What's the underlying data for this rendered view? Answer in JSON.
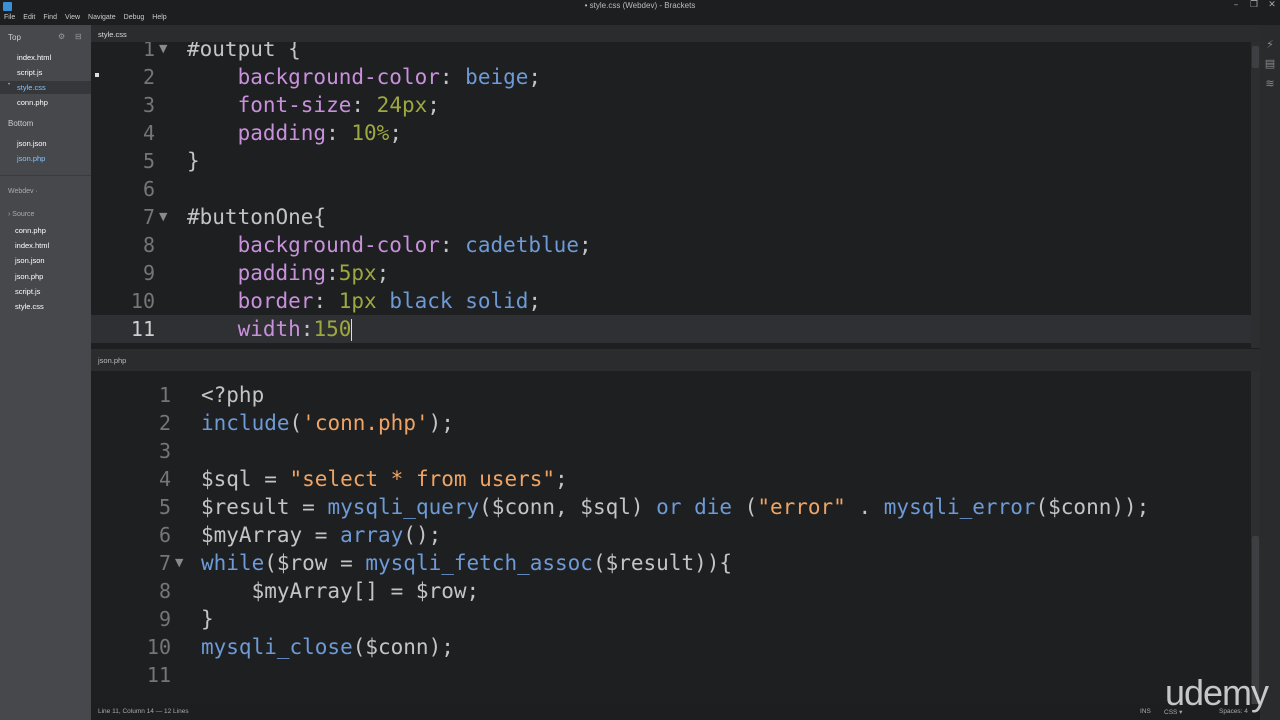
{
  "window": {
    "title": "• style.css (Webdev) - Brackets",
    "controls": [
      "–",
      "❐",
      "✕"
    ]
  },
  "menu": [
    "File",
    "Edit",
    "Find",
    "View",
    "Navigate",
    "Debug",
    "Help"
  ],
  "sidebar": {
    "top_label": "Top",
    "top_files": [
      "index.html",
      "script.js",
      "style.css",
      "conn.php"
    ],
    "bottom_label": "Bottom",
    "bottom_files": [
      "json.json",
      "json.php"
    ],
    "project_label": "Webdev ·",
    "source_label": "› Source",
    "source_files": [
      "conn.php",
      "index.html",
      "json.json",
      "json.php",
      "script.js",
      "style.css"
    ]
  },
  "top_pane": {
    "tab": "style.css",
    "lines": [
      "1",
      "2",
      "3",
      "4",
      "5",
      "6",
      "7",
      "8",
      "9",
      "10",
      "11"
    ],
    "code": [
      [
        {
          "t": "#output {",
          "c": "c-sel"
        }
      ],
      [
        {
          "t": "    background-color",
          "c": "c-prop"
        },
        {
          "t": ": ",
          "c": "c-plain"
        },
        {
          "t": "beige",
          "c": "c-val"
        },
        {
          "t": ";",
          "c": "c-plain"
        }
      ],
      [
        {
          "t": "    font-size",
          "c": "c-prop"
        },
        {
          "t": ": ",
          "c": "c-plain"
        },
        {
          "t": "24px",
          "c": "c-num"
        },
        {
          "t": ";",
          "c": "c-plain"
        }
      ],
      [
        {
          "t": "    padding",
          "c": "c-prop"
        },
        {
          "t": ": ",
          "c": "c-plain"
        },
        {
          "t": "10%",
          "c": "c-num"
        },
        {
          "t": ";",
          "c": "c-plain"
        }
      ],
      [
        {
          "t": "}",
          "c": "c-plain"
        }
      ],
      [],
      [
        {
          "t": "#buttonOne{",
          "c": "c-sel"
        }
      ],
      [
        {
          "t": "    background-color",
          "c": "c-prop"
        },
        {
          "t": ": ",
          "c": "c-plain"
        },
        {
          "t": "cadetblue",
          "c": "c-val"
        },
        {
          "t": ";",
          "c": "c-plain"
        }
      ],
      [
        {
          "t": "    padding",
          "c": "c-prop"
        },
        {
          "t": ":",
          "c": "c-plain"
        },
        {
          "t": "5px",
          "c": "c-num"
        },
        {
          "t": ";",
          "c": "c-plain"
        }
      ],
      [
        {
          "t": "    border",
          "c": "c-prop"
        },
        {
          "t": ": ",
          "c": "c-plain"
        },
        {
          "t": "1px",
          "c": "c-num"
        },
        {
          "t": " ",
          "c": "c-plain"
        },
        {
          "t": "black",
          "c": "c-val"
        },
        {
          "t": " ",
          "c": "c-plain"
        },
        {
          "t": "solid",
          "c": "c-val"
        },
        {
          "t": ";",
          "c": "c-plain"
        }
      ],
      [
        {
          "t": "    width",
          "c": "c-prop"
        },
        {
          "t": ":",
          "c": "c-plain"
        },
        {
          "t": "150",
          "c": "c-num"
        }
      ]
    ]
  },
  "bottom_pane": {
    "tab": "json.php",
    "lines": [
      "1",
      "2",
      "3",
      "4",
      "5",
      "6",
      "7",
      "8",
      "9",
      "10",
      "11"
    ],
    "code": [
      [
        {
          "t": "<?php",
          "c": "c-plain"
        }
      ],
      [
        {
          "t": "include",
          "c": "c-fn"
        },
        {
          "t": "(",
          "c": "c-plain"
        },
        {
          "t": "'conn.php'",
          "c": "c-str"
        },
        {
          "t": ");",
          "c": "c-plain"
        }
      ],
      [],
      [
        {
          "t": "$sql = ",
          "c": "c-plain"
        },
        {
          "t": "\"select * from users\"",
          "c": "c-str"
        },
        {
          "t": ";",
          "c": "c-plain"
        }
      ],
      [
        {
          "t": "$result = ",
          "c": "c-plain"
        },
        {
          "t": "mysqli_query",
          "c": "c-fn"
        },
        {
          "t": "($conn, $sql) ",
          "c": "c-plain"
        },
        {
          "t": "or die",
          "c": "c-kw"
        },
        {
          "t": " (",
          "c": "c-plain"
        },
        {
          "t": "\"error\"",
          "c": "c-str"
        },
        {
          "t": " . ",
          "c": "c-plain"
        },
        {
          "t": "mysqli_error",
          "c": "c-fn"
        },
        {
          "t": "($conn));",
          "c": "c-plain"
        }
      ],
      [
        {
          "t": "$myArray = ",
          "c": "c-plain"
        },
        {
          "t": "array",
          "c": "c-fn"
        },
        {
          "t": "();",
          "c": "c-plain"
        }
      ],
      [
        {
          "t": "while",
          "c": "c-kw"
        },
        {
          "t": "($row = ",
          "c": "c-plain"
        },
        {
          "t": "mysqli_fetch_assoc",
          "c": "c-fn"
        },
        {
          "t": "($result)){",
          "c": "c-plain"
        }
      ],
      [
        {
          "t": "    $myArray[] = $row;",
          "c": "c-plain"
        }
      ],
      [
        {
          "t": "}",
          "c": "c-plain"
        }
      ],
      [
        {
          "t": "mysqli_close",
          "c": "c-fn"
        },
        {
          "t": "($conn);",
          "c": "c-plain"
        }
      ],
      []
    ]
  },
  "status": {
    "cursor": "Line 11, Column 14 — 12 Lines",
    "mode": "INS",
    "language": "CSS ▾",
    "spaces": "Spaces: 4"
  },
  "watermark": "udemy"
}
